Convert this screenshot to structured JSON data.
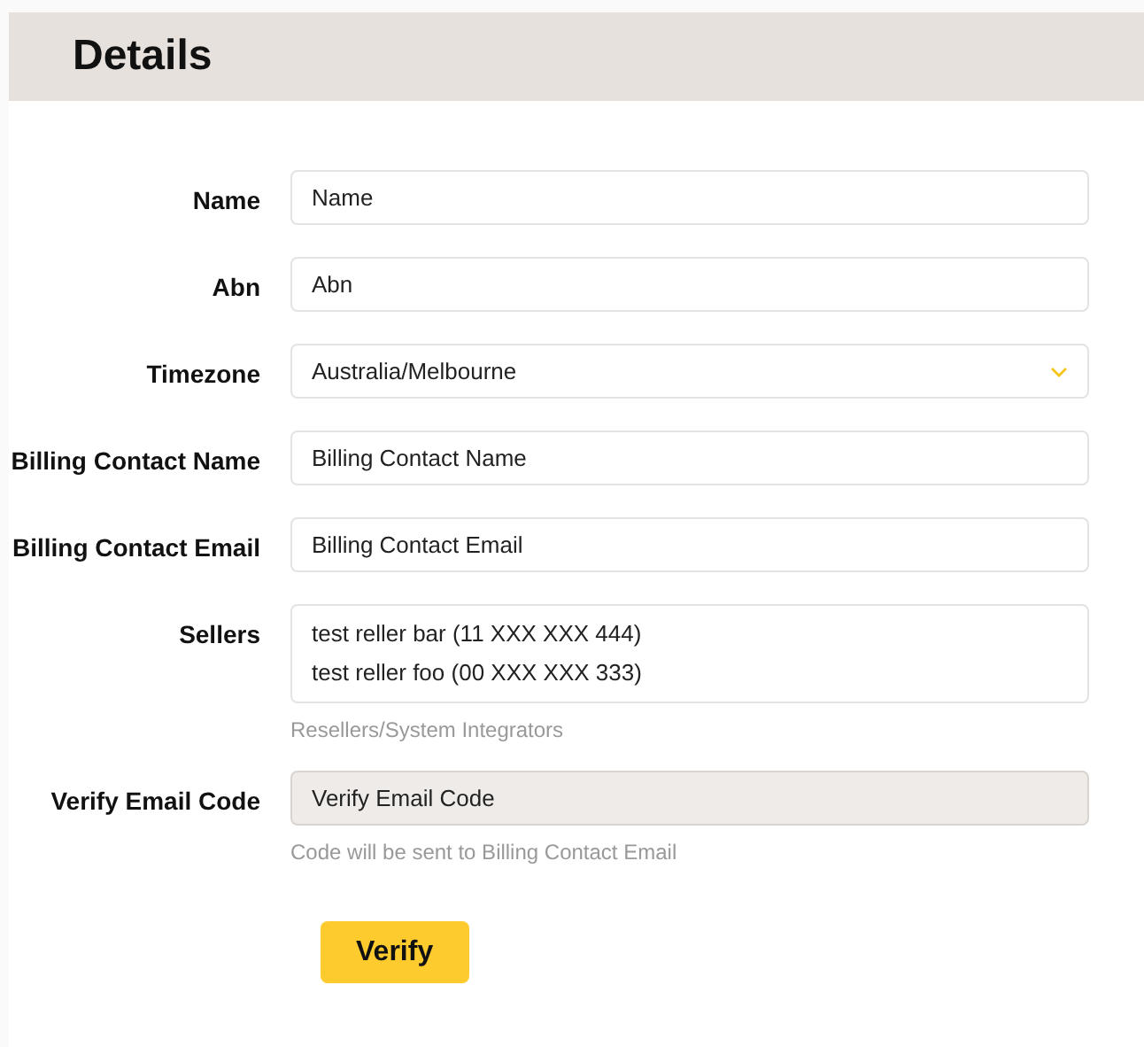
{
  "header": {
    "title": "Details"
  },
  "fields": [
    {
      "kind": "text",
      "label": "Name",
      "value": "Name",
      "disabled": false
    },
    {
      "kind": "text",
      "label": "Abn",
      "value": "Abn",
      "disabled": false
    },
    {
      "kind": "select",
      "label": "Timezone",
      "value": "Australia/Melbourne"
    },
    {
      "kind": "text",
      "label": "Billing Contact Name",
      "value": "Billing Contact Name",
      "disabled": false
    },
    {
      "kind": "text",
      "label": "Billing Contact Email",
      "value": "Billing Contact Email",
      "disabled": false
    },
    {
      "kind": "list",
      "label": "Sellers",
      "items": [
        "test reller bar (11 XXX XXX 444)",
        "test reller foo (00 XXX XXX 333)"
      ],
      "helper": "Resellers/System Integrators"
    },
    {
      "kind": "text",
      "label": "Verify Email Code",
      "value": "Verify Email Code",
      "disabled": true,
      "helper": "Code will be sent to Billing Contact Email"
    }
  ],
  "button": {
    "label": "Verify"
  }
}
